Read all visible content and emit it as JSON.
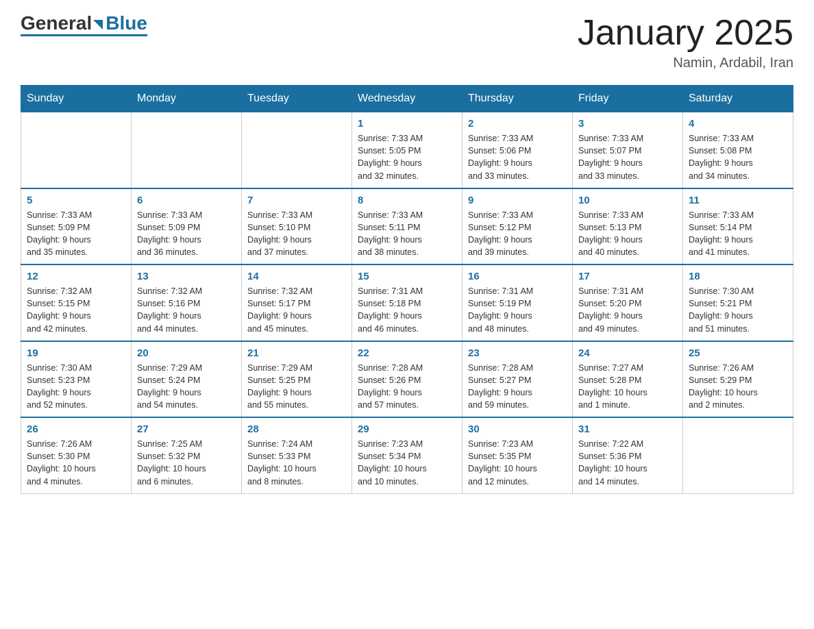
{
  "header": {
    "logo_general": "General",
    "logo_blue": "Blue",
    "title": "January 2025",
    "subtitle": "Namin, Ardabil, Iran"
  },
  "days_of_week": [
    "Sunday",
    "Monday",
    "Tuesday",
    "Wednesday",
    "Thursday",
    "Friday",
    "Saturday"
  ],
  "weeks": [
    [
      {
        "day": "",
        "info": ""
      },
      {
        "day": "",
        "info": ""
      },
      {
        "day": "",
        "info": ""
      },
      {
        "day": "1",
        "info": "Sunrise: 7:33 AM\nSunset: 5:05 PM\nDaylight: 9 hours\nand 32 minutes."
      },
      {
        "day": "2",
        "info": "Sunrise: 7:33 AM\nSunset: 5:06 PM\nDaylight: 9 hours\nand 33 minutes."
      },
      {
        "day": "3",
        "info": "Sunrise: 7:33 AM\nSunset: 5:07 PM\nDaylight: 9 hours\nand 33 minutes."
      },
      {
        "day": "4",
        "info": "Sunrise: 7:33 AM\nSunset: 5:08 PM\nDaylight: 9 hours\nand 34 minutes."
      }
    ],
    [
      {
        "day": "5",
        "info": "Sunrise: 7:33 AM\nSunset: 5:09 PM\nDaylight: 9 hours\nand 35 minutes."
      },
      {
        "day": "6",
        "info": "Sunrise: 7:33 AM\nSunset: 5:09 PM\nDaylight: 9 hours\nand 36 minutes."
      },
      {
        "day": "7",
        "info": "Sunrise: 7:33 AM\nSunset: 5:10 PM\nDaylight: 9 hours\nand 37 minutes."
      },
      {
        "day": "8",
        "info": "Sunrise: 7:33 AM\nSunset: 5:11 PM\nDaylight: 9 hours\nand 38 minutes."
      },
      {
        "day": "9",
        "info": "Sunrise: 7:33 AM\nSunset: 5:12 PM\nDaylight: 9 hours\nand 39 minutes."
      },
      {
        "day": "10",
        "info": "Sunrise: 7:33 AM\nSunset: 5:13 PM\nDaylight: 9 hours\nand 40 minutes."
      },
      {
        "day": "11",
        "info": "Sunrise: 7:33 AM\nSunset: 5:14 PM\nDaylight: 9 hours\nand 41 minutes."
      }
    ],
    [
      {
        "day": "12",
        "info": "Sunrise: 7:32 AM\nSunset: 5:15 PM\nDaylight: 9 hours\nand 42 minutes."
      },
      {
        "day": "13",
        "info": "Sunrise: 7:32 AM\nSunset: 5:16 PM\nDaylight: 9 hours\nand 44 minutes."
      },
      {
        "day": "14",
        "info": "Sunrise: 7:32 AM\nSunset: 5:17 PM\nDaylight: 9 hours\nand 45 minutes."
      },
      {
        "day": "15",
        "info": "Sunrise: 7:31 AM\nSunset: 5:18 PM\nDaylight: 9 hours\nand 46 minutes."
      },
      {
        "day": "16",
        "info": "Sunrise: 7:31 AM\nSunset: 5:19 PM\nDaylight: 9 hours\nand 48 minutes."
      },
      {
        "day": "17",
        "info": "Sunrise: 7:31 AM\nSunset: 5:20 PM\nDaylight: 9 hours\nand 49 minutes."
      },
      {
        "day": "18",
        "info": "Sunrise: 7:30 AM\nSunset: 5:21 PM\nDaylight: 9 hours\nand 51 minutes."
      }
    ],
    [
      {
        "day": "19",
        "info": "Sunrise: 7:30 AM\nSunset: 5:23 PM\nDaylight: 9 hours\nand 52 minutes."
      },
      {
        "day": "20",
        "info": "Sunrise: 7:29 AM\nSunset: 5:24 PM\nDaylight: 9 hours\nand 54 minutes."
      },
      {
        "day": "21",
        "info": "Sunrise: 7:29 AM\nSunset: 5:25 PM\nDaylight: 9 hours\nand 55 minutes."
      },
      {
        "day": "22",
        "info": "Sunrise: 7:28 AM\nSunset: 5:26 PM\nDaylight: 9 hours\nand 57 minutes."
      },
      {
        "day": "23",
        "info": "Sunrise: 7:28 AM\nSunset: 5:27 PM\nDaylight: 9 hours\nand 59 minutes."
      },
      {
        "day": "24",
        "info": "Sunrise: 7:27 AM\nSunset: 5:28 PM\nDaylight: 10 hours\nand 1 minute."
      },
      {
        "day": "25",
        "info": "Sunrise: 7:26 AM\nSunset: 5:29 PM\nDaylight: 10 hours\nand 2 minutes."
      }
    ],
    [
      {
        "day": "26",
        "info": "Sunrise: 7:26 AM\nSunset: 5:30 PM\nDaylight: 10 hours\nand 4 minutes."
      },
      {
        "day": "27",
        "info": "Sunrise: 7:25 AM\nSunset: 5:32 PM\nDaylight: 10 hours\nand 6 minutes."
      },
      {
        "day": "28",
        "info": "Sunrise: 7:24 AM\nSunset: 5:33 PM\nDaylight: 10 hours\nand 8 minutes."
      },
      {
        "day": "29",
        "info": "Sunrise: 7:23 AM\nSunset: 5:34 PM\nDaylight: 10 hours\nand 10 minutes."
      },
      {
        "day": "30",
        "info": "Sunrise: 7:23 AM\nSunset: 5:35 PM\nDaylight: 10 hours\nand 12 minutes."
      },
      {
        "day": "31",
        "info": "Sunrise: 7:22 AM\nSunset: 5:36 PM\nDaylight: 10 hours\nand 14 minutes."
      },
      {
        "day": "",
        "info": ""
      }
    ]
  ]
}
